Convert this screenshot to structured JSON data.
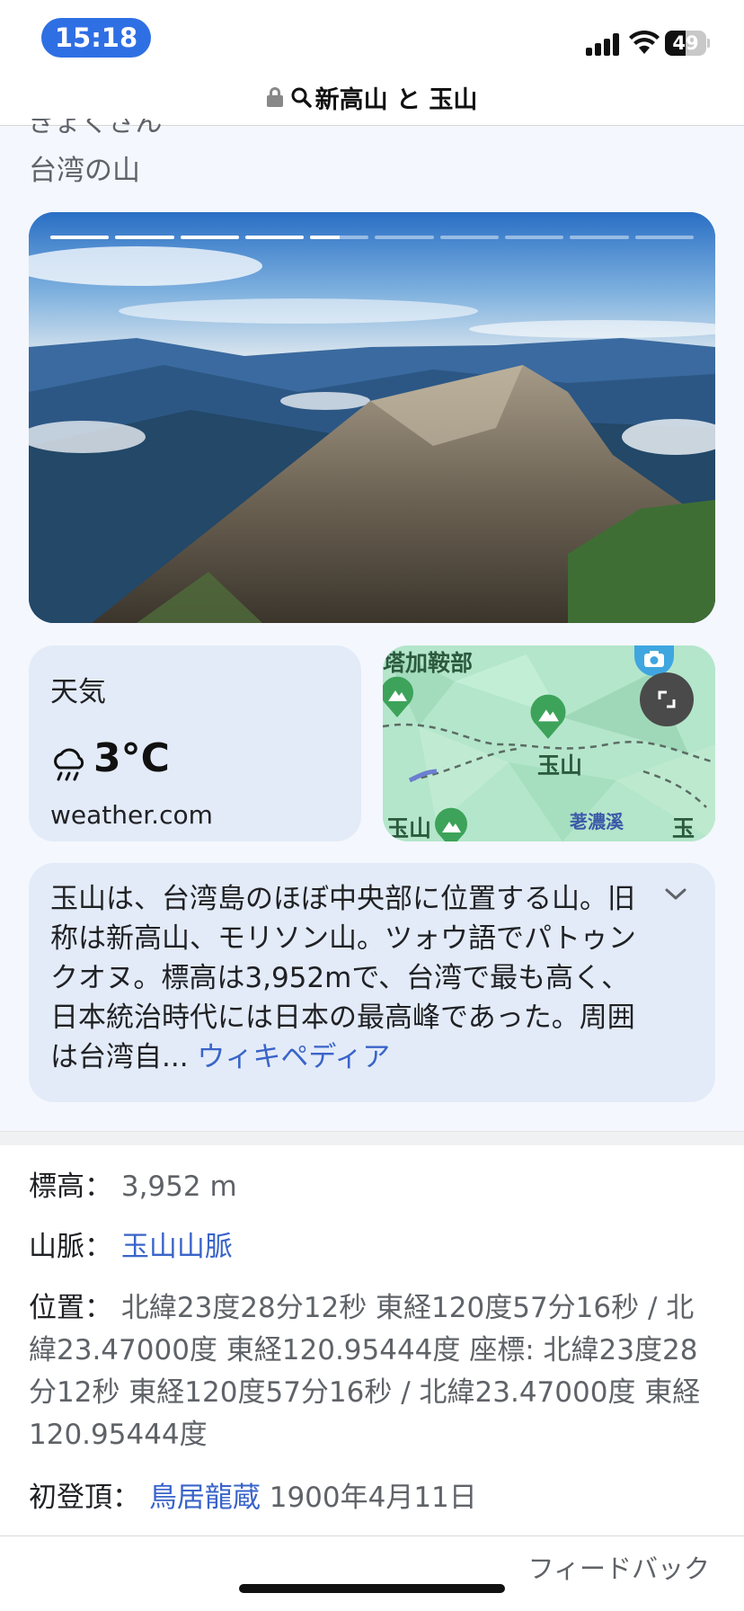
{
  "status_bar": {
    "time": "15:18",
    "battery": "49",
    "battery_level": 0.49,
    "icons": [
      "cellular-signal-icon",
      "wifi-icon",
      "battery-icon"
    ]
  },
  "address_bar": {
    "query": "新高山 と 玉山",
    "icons": [
      "lock-icon",
      "search-icon"
    ]
  },
  "header": {
    "title_partial": "ぎょくざん",
    "subtitle": "台湾の山"
  },
  "hero_image": {
    "slide_count": 10,
    "current_slide": 5,
    "current_progress": 0.5
  },
  "weather": {
    "label": "天気",
    "temperature": "3°C",
    "source": "weather.com",
    "icon": "rain-cloud-icon"
  },
  "map": {
    "labels": {
      "top_left": "塔加鞍部",
      "center": "玉山",
      "bottom_left": "玉山",
      "bottom_center": "荖濃溪",
      "bottom_right": "玉山"
    },
    "icons": [
      "mountain-pin-icon",
      "camera-icon",
      "expand-icon"
    ]
  },
  "description": {
    "text": "玉山は、台湾島のほぼ中央部に位置する山。旧称は新高山、モリソン山。ツォウ語でパトゥンクオヌ。標高は3,952mで、台湾で最も高く、日本統治時代には日本の最高峰であった。周囲は台湾自...",
    "source_link": "ウィキペディア"
  },
  "facts": {
    "elevation": {
      "label": "標高：",
      "value": "3,952 m"
    },
    "range": {
      "label": "山脈：",
      "value": "玉山山脈"
    },
    "location": {
      "label": "位置：",
      "value": "北緯23度28分12秒 東経120度57分16秒 / 北緯23.47000度 東経120.95444度 座標: 北緯23度28分12秒 東経120度57分16秒 / 北緯23.47000度 東経120.95444度"
    },
    "first_ascent": {
      "label": "初登頂：",
      "person": "鳥居龍蔵",
      "date": "1900年4月11日"
    }
  },
  "footer": {
    "feedback": "フィードバック"
  },
  "colors": {
    "accent_blue": "#2f6fe4",
    "link_blue": "#3a64c9",
    "card_bg": "#e3ebf8"
  }
}
